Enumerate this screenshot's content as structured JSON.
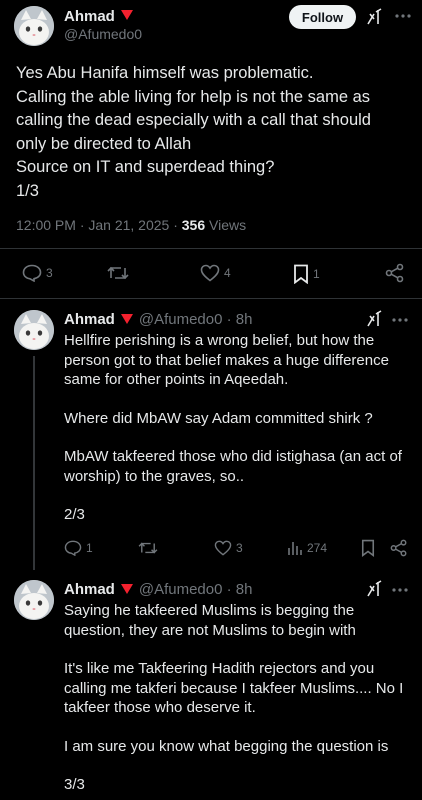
{
  "main": {
    "name": "Ahmad",
    "handle": "@Afumedo0",
    "follow_label": "Follow",
    "text_lines": [
      "Yes Abu Hanifa himself was problematic.",
      "Calling the able living for help is not the same as",
      "calling the dead especially with a call that should",
      "only be directed to Allah",
      "Source on IT and superdead thing?",
      "1/3"
    ],
    "timestamp": "12:00 PM · Jan 21, 2025 · ",
    "views_count": "356",
    "views_label": " Views",
    "replies": "3",
    "likes": "4",
    "bookmarks": "1"
  },
  "reply1": {
    "name": "Ahmad",
    "handle": "@Afumedo0 · 8h",
    "lines": [
      "Hellfire perishing is a wrong belief, but how the",
      "person got to that belief makes a huge difference",
      "same for other points in Aqeedah.",
      "",
      "Where did MbAW say Adam committed shirk ?",
      "",
      "MbAW takfeered those who did istighasa (an act of",
      "worship) to the graves, so..",
      "",
      "2/3"
    ],
    "replies": "1",
    "likes": "3",
    "views": "274"
  },
  "reply2": {
    "name": "Ahmad",
    "handle": "@Afumedo0 · 8h",
    "lines": [
      "Saying he takfeered Muslims is begging the",
      "question, they are not Muslims to begin with",
      "",
      "It's like me Takfeering Hadith rejectors and you",
      "calling me takferi because I takfeer Muslims.... No I",
      "takfeer those who deserve it.",
      "",
      "I am sure you know what begging the question is",
      "",
      "3/3"
    ]
  },
  "colors": {
    "background": "#000000",
    "text": "#e7e9ea",
    "muted": "#71767b",
    "badge": "#f4212e",
    "follow_bg": "#eff3f4",
    "divider": "#2f3336"
  }
}
